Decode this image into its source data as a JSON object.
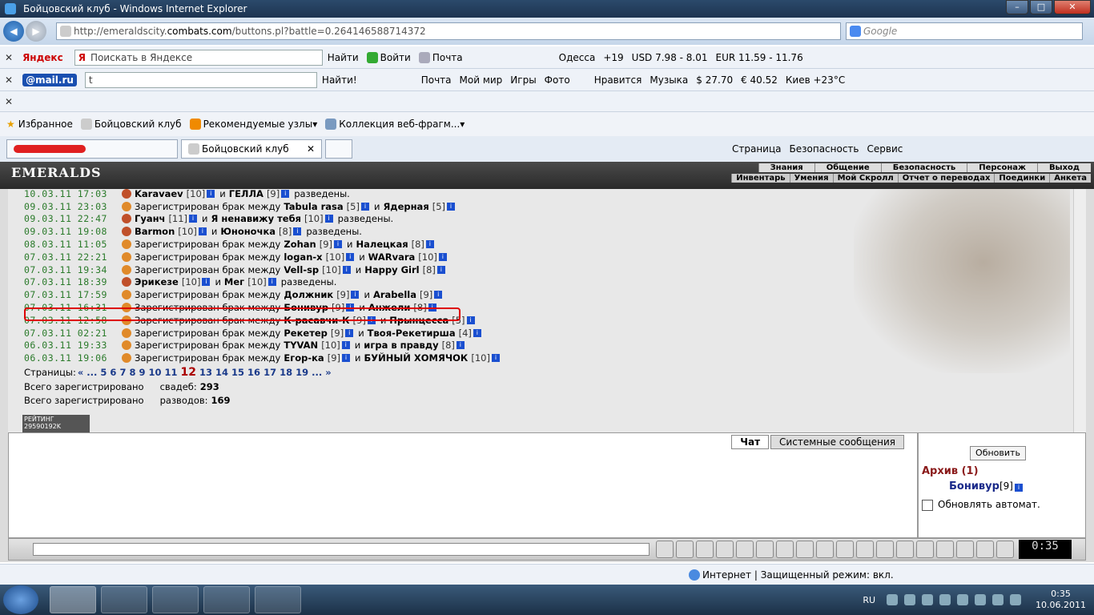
{
  "window": {
    "title": "Бойцовский клуб - Windows Internet Explorer"
  },
  "address": {
    "url_prefix": "http://emeraldscity.",
    "url_domain": "combats.com",
    "url_suffix": "/buttons.pl?battle=0.264146588714372",
    "search_placeholder": "Google"
  },
  "yandex": {
    "brand": "Яндекс",
    "search_placeholder": "Поискать в Яндексе",
    "find": "Найти",
    "login": "Войти",
    "mail": "Почта",
    "city": "Одесса",
    "temp": "+19",
    "usd": "USD 7.98 - 8.01",
    "eur": "EUR 11.59 - 11.76"
  },
  "mailru": {
    "brand": "@mail.ru",
    "query": "t",
    "find": "Найти!",
    "mail": "Почта",
    "myworld": "Мой мир",
    "games": "Игры",
    "photo": "Фото",
    "like": "Нравится",
    "music": "Музыка",
    "usd": "$ 27.70",
    "eur": "€ 40.52",
    "weather": "Киев +23°C"
  },
  "favorites": {
    "label": "Избранное",
    "item1": "Бойцовский клуб",
    "item2": "Рекомендуемые узлы",
    "item3": "Коллекция веб-фрагм..."
  },
  "tabs": {
    "active": "Бойцовский клуб",
    "page": "Страница",
    "security": "Безопасность",
    "service": "Сервис"
  },
  "game": {
    "logo": "EMERALDS",
    "menu1": [
      "Знания",
      "Общение",
      "Безопасность",
      "Персонаж",
      "Выход"
    ],
    "menu2": [
      "Инвентарь",
      "Умения",
      "Мой Скролл",
      "Отчет о переводах",
      "Поединки",
      "Анкета"
    ],
    "entries": [
      {
        "date": "10.03.11 17:03",
        "type": "div",
        "n1": "Karavaev",
        "l1": "[10]",
        "mid": "и",
        "n2": "ГЕЛЛА",
        "l2": "[9]",
        "end": "разведены."
      },
      {
        "date": "09.03.11 23:03",
        "type": "mar",
        "pre": "Зарегистрирован брак между",
        "n1": "Tabula rasa",
        "l1": "[5]",
        "mid": "и",
        "n2": "Ядерная",
        "l2": "[5]",
        "end": ""
      },
      {
        "date": "09.03.11 22:47",
        "type": "div",
        "n1": "Гуанч",
        "l1": "[11]",
        "mid": "и",
        "n2": "Я ненавижу тебя",
        "l2": "[10]",
        "end": "разведены."
      },
      {
        "date": "09.03.11 19:08",
        "type": "div",
        "n1": "Barmon",
        "l1": "[10]",
        "mid": "и",
        "n2": "Юноночка",
        "l2": "[8]",
        "end": "разведены."
      },
      {
        "date": "08.03.11 11:05",
        "type": "mar",
        "pre": "Зарегистрирован брак между",
        "n1": "Zohan",
        "l1": "[9]",
        "mid": "и",
        "n2": "Налецкая",
        "l2": "[8]",
        "end": ""
      },
      {
        "date": "07.03.11 22:21",
        "type": "mar",
        "pre": "Зарегистрирован брак между",
        "n1": "logan-x",
        "l1": "[10]",
        "mid": "и",
        "n2": "WARvara",
        "l2": "[10]",
        "end": ""
      },
      {
        "date": "07.03.11 19:34",
        "type": "mar",
        "pre": "Зарегистрирован брак между",
        "n1": "Vell-sp",
        "l1": "[10]",
        "mid": "и",
        "n2": "Happy Girl",
        "l2": "[8]",
        "end": ""
      },
      {
        "date": "07.03.11 18:39",
        "type": "div",
        "n1": "Эрикезе",
        "l1": "[10]",
        "mid": "и",
        "n2": "Мег",
        "l2": "[10]",
        "end": "разведены."
      },
      {
        "date": "07.03.11 17:59",
        "type": "mar",
        "pre": "Зарегистрирован брак между",
        "n1": "Должник",
        "l1": "[9]",
        "mid": "и",
        "n2": "Arabella",
        "l2": "[9]",
        "end": ""
      },
      {
        "date": "07.03.11 16:31",
        "type": "mar",
        "pre": "Зарегистрирован брак между",
        "n1": "Бонивур",
        "l1": "[9]",
        "mid": "и",
        "n2": "Анжели",
        "l2": "[8]",
        "end": ""
      },
      {
        "date": "07.03.11 12:58",
        "type": "mar",
        "pre": "Зарегистрирован брак между",
        "n1": "К-расавчи-К",
        "l1": "[9]",
        "mid": "и",
        "n2": "Прынцесса",
        "l2": "[5]",
        "end": ""
      },
      {
        "date": "07.03.11 02:21",
        "type": "mar",
        "pre": "Зарегистрирован брак между",
        "n1": "Рекетер",
        "l1": "[9]",
        "mid": "и",
        "n2": "Твоя-Рекетирша",
        "l2": "[4]",
        "end": ""
      },
      {
        "date": "06.03.11 19:33",
        "type": "mar",
        "pre": "Зарегистрирован брак между",
        "n1": "TYVAN",
        "l1": "[10]",
        "mid": "и",
        "n2": "игра в правду",
        "l2": "[8]",
        "end": ""
      },
      {
        "date": "06.03.11 19:06",
        "type": "mar",
        "pre": "Зарегистрирован брак между",
        "n1": "Егор-ка",
        "l1": "[9]",
        "mid": "и",
        "n2": "БУЙНЫЙ ХОМЯЧОК",
        "l2": "[10]",
        "end": ""
      }
    ],
    "pages_label": "Страницы:",
    "pages": [
      "«",
      "...",
      "5",
      "6",
      "7",
      "8",
      "9",
      "10",
      "11",
      "12",
      "13",
      "14",
      "15",
      "16",
      "17",
      "18",
      "19",
      "...",
      "»"
    ],
    "current_page": "12",
    "weddings_label": "Всего зарегистрировано",
    "weddings_word": "свадеб:",
    "weddings_count": "293",
    "divorces_label": "Всего зарегистрировано",
    "divorces_word": "разводов:",
    "divorces_count": "169",
    "counter": "РЕЙТИНГ 29590192K"
  },
  "chat": {
    "tab_chat": "Чат",
    "tab_system": "Системные сообщения",
    "refresh": "Обновить",
    "archive": "Архив (1)",
    "archive_nick": "Бонивур",
    "archive_level": "[9]",
    "auto_refresh": "Обновлять автомат.",
    "clock": "0:35"
  },
  "status": {
    "zone": "Интернет | Защищенный режим: вкл."
  },
  "taskbar": {
    "lang": "RU",
    "time": "0:35",
    "date": "10.06.2011"
  }
}
